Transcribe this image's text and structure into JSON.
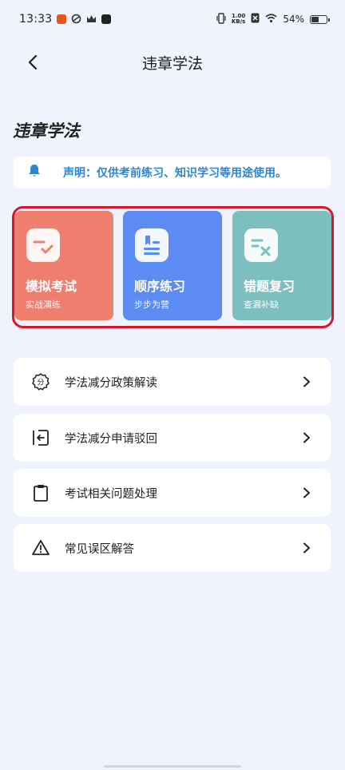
{
  "status_bar": {
    "time": "13:33",
    "speed_top": "1.00",
    "speed_bottom": "KB/s",
    "battery": "54%"
  },
  "header": {
    "title": "违章学法"
  },
  "section": {
    "title": "违章学法"
  },
  "notice": {
    "text": "声明：仅供考前练习、知识学习等用途使用。"
  },
  "cards": [
    {
      "title": "模拟考试",
      "subtitle": "实战演练",
      "icon": "exam-icon",
      "color": "#f07e6e"
    },
    {
      "title": "顺序练习",
      "subtitle": "步步为营",
      "icon": "book-icon",
      "color": "#5b8bf3"
    },
    {
      "title": "错题复习",
      "subtitle": "查漏补缺",
      "icon": "wrong-answer-icon",
      "color": "#7bbfbf"
    }
  ],
  "menu": [
    {
      "label": "学法减分政策解读",
      "icon": "points-badge-icon"
    },
    {
      "label": "学法减分申请驳回",
      "icon": "return-icon"
    },
    {
      "label": "考试相关问题处理",
      "icon": "clipboard-icon"
    },
    {
      "label": "常见误区解答",
      "icon": "warning-icon"
    }
  ],
  "colors": {
    "accent": "#2a86d6",
    "highlight_border": "#d7162a",
    "background": "#eef3fd"
  }
}
